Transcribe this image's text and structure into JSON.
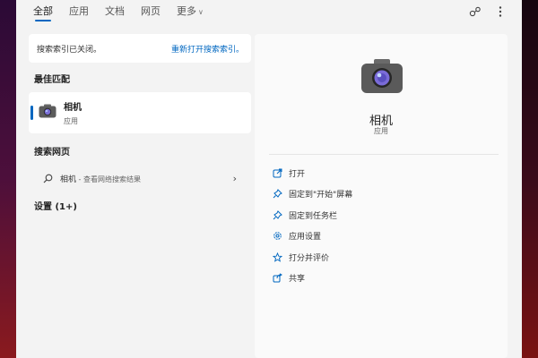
{
  "tabs": [
    {
      "label": "全部"
    },
    {
      "label": "应用"
    },
    {
      "label": "文档"
    },
    {
      "label": "网页"
    },
    {
      "label": "更多"
    }
  ],
  "notice": {
    "message": "搜索索引已关闭。",
    "link": "重新打开搜索索引。"
  },
  "best_match": {
    "heading": "最佳匹配",
    "name": "相机",
    "type": "应用",
    "icon": "camera-icon"
  },
  "web_search": {
    "heading": "搜索网页",
    "query": "相机",
    "suffix": " - 查看网络搜索结果"
  },
  "settings": {
    "heading": "设置 (1+)"
  },
  "detail": {
    "title": "相机",
    "subtitle": "应用",
    "actions": [
      {
        "label": "打开",
        "icon": "open-icon"
      },
      {
        "label": "固定到\"开始\"屏幕",
        "icon": "pin-icon"
      },
      {
        "label": "固定到任务栏",
        "icon": "pin-icon"
      },
      {
        "label": "应用设置",
        "icon": "gear-icon"
      },
      {
        "label": "打分并评价",
        "icon": "star-icon"
      },
      {
        "label": "共享",
        "icon": "share-icon"
      }
    ]
  },
  "colors": {
    "accent": "#0067c0",
    "panel": "#f3f3f3"
  }
}
